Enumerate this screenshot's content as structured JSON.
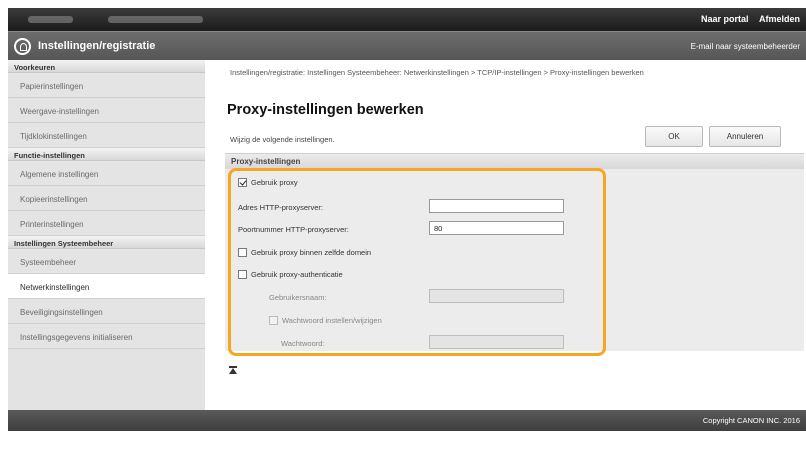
{
  "header": {
    "top_links": [
      "Naar portal",
      "Afmelden"
    ],
    "title": "Instellingen/registratie",
    "email_link": "E-mail naar systeembeheerder"
  },
  "sidebar": {
    "sections": [
      {
        "header": "Voorkeuren",
        "items": [
          "Papierinstellingen",
          "Weergave-instellingen",
          "Tijdklokinstellingen"
        ]
      },
      {
        "header": "Functie-instellingen",
        "items": [
          "Algemene instellingen",
          "Kopieerinstellingen",
          "Printerinstellingen"
        ]
      },
      {
        "header": "Instellingen Systeembeheer",
        "items": [
          "Systeembeheer",
          "Netwerkinstellingen",
          "Beveiligingsinstellingen",
          "Instellingsgegevens initialiseren"
        ]
      }
    ],
    "active_item": "Netwerkinstellingen"
  },
  "main": {
    "breadcrumb": "Instellingen/registratie: Instellingen Systeembeheer: Netwerkinstellingen > TCP/IP-instellingen > Proxy-instellingen bewerken",
    "page_title": "Proxy-instellingen bewerken",
    "instruction": "Wijzig de volgende instellingen.",
    "ok_label": "OK",
    "cancel_label": "Annuleren",
    "section_title": "Proxy-instellingen",
    "fields": {
      "use_proxy_label": "Gebruik proxy",
      "use_proxy_checked": true,
      "http_proxy_label": "Adres HTTP-proxyserver:",
      "http_proxy_value": "",
      "port_label": "Poortnummer HTTP-proxyserver:",
      "port_value": "80",
      "same_domain_label": "Gebruik proxy binnen zelfde domein",
      "same_domain_checked": false,
      "auth_label": "Gebruik proxy-authenticatie",
      "auth_checked": false,
      "username_label": "Gebruikersnaam:",
      "username_value": "",
      "set_password_label": "Wachtwoord instellen/wijzigen",
      "password_label": "Wachtwoord:",
      "password_value": ""
    }
  },
  "footer": {
    "copyright": "Copyright CANON INC. 2016"
  },
  "colors": {
    "highlight": "#f5a623",
    "topbar": "#2a2a2a",
    "titlebar": "#626262"
  }
}
